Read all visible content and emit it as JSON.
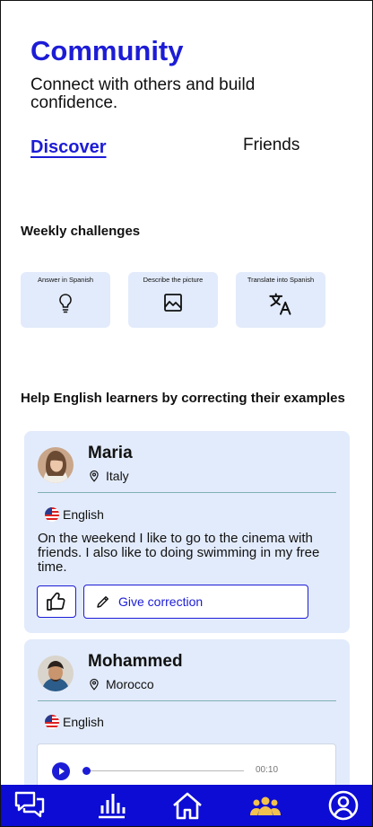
{
  "header": {
    "title": "Community",
    "subtitle": "Connect with others and build confidence."
  },
  "tabs": [
    {
      "label": "Discover",
      "active": true
    },
    {
      "label": "Friends",
      "active": false
    }
  ],
  "weekly": {
    "heading": "Weekly challenges",
    "items": [
      {
        "label": "Answer in Spanish",
        "icon": "lightbulb-icon"
      },
      {
        "label": "Describe the picture",
        "icon": "image-icon"
      },
      {
        "label": "Translate into Spanish",
        "icon": "translate-icon"
      }
    ]
  },
  "help": {
    "heading": "Help English learners by correcting their examples"
  },
  "posts": [
    {
      "name": "Maria",
      "location": "Italy",
      "language": "English",
      "text": "On the weekend I like to go to the cinema with friends. I also like to doing swimming in my free time.",
      "correction_label": "Give correction"
    },
    {
      "name": "Mohammed",
      "location": "Morocco",
      "language": "English",
      "audio_time": "00:10"
    }
  ],
  "nav": [
    {
      "icon": "chat-icon",
      "active": false
    },
    {
      "icon": "stats-icon",
      "active": false
    },
    {
      "icon": "home-icon",
      "active": false
    },
    {
      "icon": "community-icon",
      "active": true
    },
    {
      "icon": "profile-icon",
      "active": false
    }
  ],
  "colors": {
    "accent": "#1c1cd6",
    "card": "#e2ebfb",
    "navbar": "#0c0cd4",
    "active_nav": "#f2c14e"
  }
}
